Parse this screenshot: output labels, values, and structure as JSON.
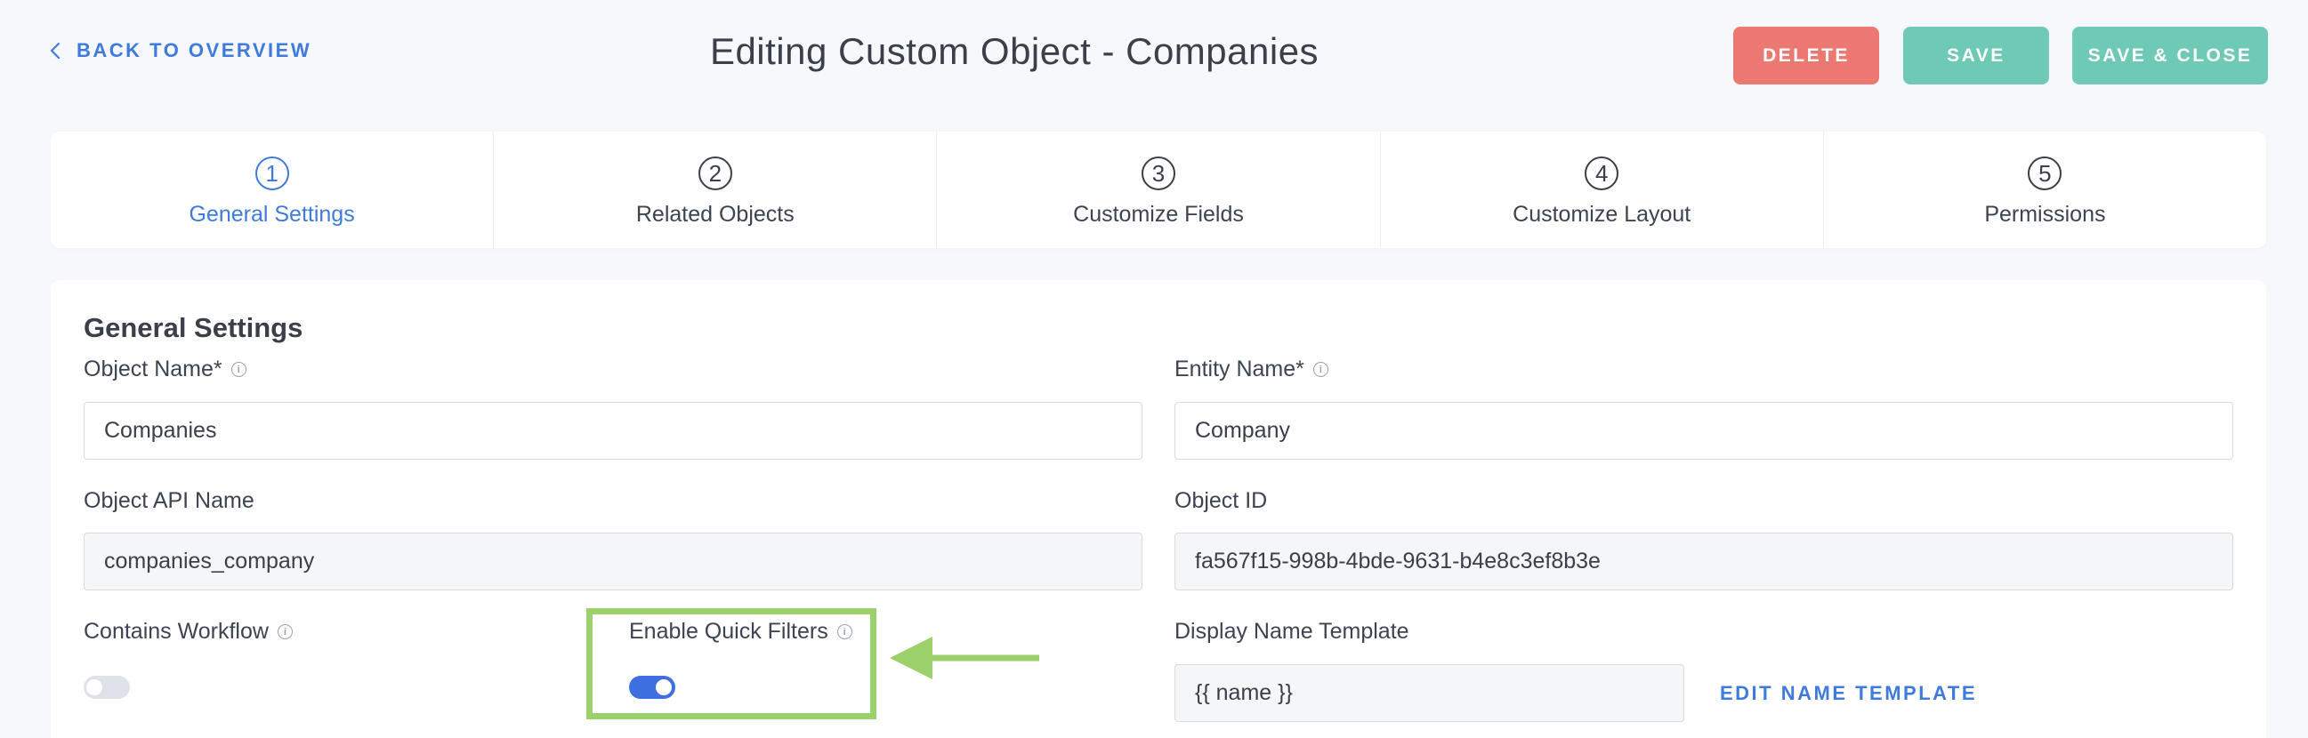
{
  "header": {
    "back_label": "BACK TO OVERVIEW",
    "title": "Editing Custom Object - Companies",
    "buttons": {
      "delete": "DELETE",
      "save": "SAVE",
      "save_close": "SAVE & CLOSE"
    }
  },
  "steps": [
    {
      "number": "1",
      "label": "General Settings",
      "active": true
    },
    {
      "number": "2",
      "label": "Related Objects",
      "active": false
    },
    {
      "number": "3",
      "label": "Customize Fields",
      "active": false
    },
    {
      "number": "4",
      "label": "Customize Layout",
      "active": false
    },
    {
      "number": "5",
      "label": "Permissions",
      "active": false
    }
  ],
  "general": {
    "title": "General Settings",
    "object_name": {
      "label": "Object Name*",
      "value": "Companies"
    },
    "entity_name": {
      "label": "Entity Name*",
      "value": "Company"
    },
    "api_name": {
      "label": "Object API Name",
      "value": "companies_company"
    },
    "object_id": {
      "label": "Object ID",
      "value": "fa567f15-998b-4bde-9631-b4e8c3ef8b3e"
    },
    "contains_workflow": {
      "label": "Contains Workflow",
      "enabled": false
    },
    "quick_filters": {
      "label": "Enable Quick Filters",
      "enabled": true
    },
    "display_template": {
      "label": "Display Name Template",
      "value": "{{ name }}",
      "edit_label": "EDIT NAME TEMPLATE"
    }
  },
  "colors": {
    "accent": "#3f7bdc",
    "delete": "#ec7872",
    "save": "#6ec9b7",
    "annotation": "#9bd06b"
  },
  "icons": {
    "back": "chevron-left-icon",
    "info": "info-icon",
    "annotation_arrow": "arrow-left-icon"
  }
}
